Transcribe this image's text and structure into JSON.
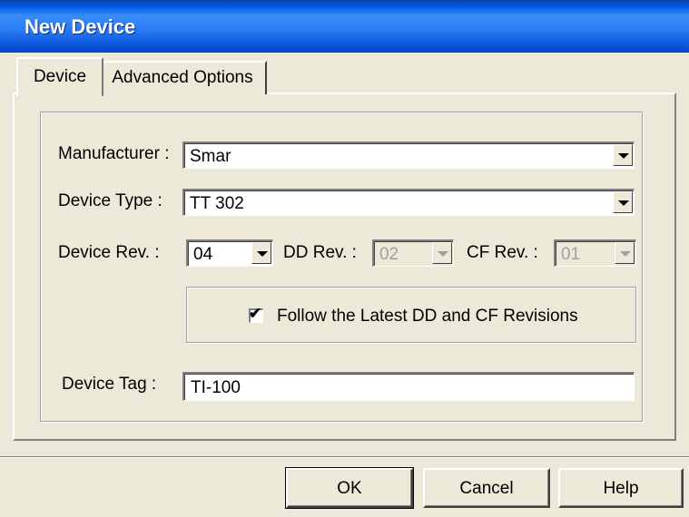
{
  "window": {
    "title": "New Device"
  },
  "tabs": [
    {
      "label": "Device",
      "selected": true
    },
    {
      "label": "Advanced Options",
      "selected": false
    }
  ],
  "form": {
    "manufacturer": {
      "label": "Manufacturer :",
      "value": "Smar"
    },
    "device_type": {
      "label": "Device Type :",
      "value": "TT 302"
    },
    "device_rev": {
      "label": "Device Rev. :",
      "value": "04"
    },
    "dd_rev": {
      "label": "DD Rev. :",
      "value": "02",
      "enabled": false
    },
    "cf_rev": {
      "label": "CF Rev. :",
      "value": "01",
      "enabled": false
    },
    "follow_latest": {
      "label": "Follow the Latest DD and CF Revisions",
      "checked": true
    },
    "device_tag": {
      "label": "Device Tag :",
      "value": "TI-100"
    }
  },
  "buttons": {
    "ok": "OK",
    "cancel": "Cancel",
    "help": "Help"
  },
  "icons": {
    "dropdown": "chevron-down-icon",
    "check": "checkmark-icon"
  },
  "colors": {
    "titlebar": "#0058e6",
    "face": "#ece9d8",
    "title_text": "#ffffff"
  }
}
